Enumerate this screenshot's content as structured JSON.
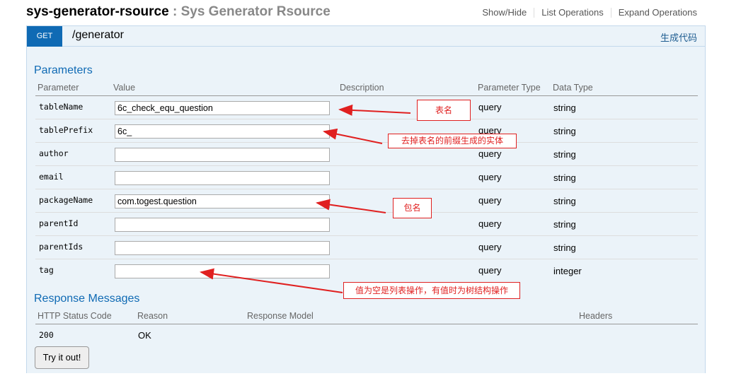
{
  "resource": {
    "name": "sys-generator-rsource",
    "separator": " : ",
    "description": "Sys Generator Rsource",
    "links": [
      "Show/Hide",
      "List Operations",
      "Expand Operations"
    ]
  },
  "operation": {
    "method": "GET",
    "path": "/generator",
    "generate_link": "生成代码",
    "parameters_title": "Parameters",
    "param_headers": [
      "Parameter",
      "Value",
      "Description",
      "Parameter Type",
      "Data Type"
    ],
    "params": [
      {
        "name": "tableName",
        "value": "6c_check_equ_question",
        "type": "query",
        "datatype": "string"
      },
      {
        "name": "tablePrefix",
        "value": "6c_",
        "type": "query",
        "datatype": "string"
      },
      {
        "name": "author",
        "value": "",
        "type": "query",
        "datatype": "string"
      },
      {
        "name": "email",
        "value": "",
        "type": "query",
        "datatype": "string"
      },
      {
        "name": "packageName",
        "value": "com.togest.question",
        "type": "query",
        "datatype": "string"
      },
      {
        "name": "parentId",
        "value": "",
        "type": "query",
        "datatype": "string"
      },
      {
        "name": "parentIds",
        "value": "",
        "type": "query",
        "datatype": "string"
      },
      {
        "name": "tag",
        "value": "",
        "type": "query",
        "datatype": "integer"
      }
    ],
    "response_title": "Response Messages",
    "response_headers": [
      "HTTP Status Code",
      "Reason",
      "Response Model",
      "Headers"
    ],
    "responses": [
      {
        "code": "200",
        "reason": "OK"
      }
    ],
    "try_button": "Try it out!"
  },
  "annotations": [
    {
      "text": "表名"
    },
    {
      "text": "去掉表名的前缀生成的实体"
    },
    {
      "text": "包名"
    },
    {
      "text": "值为空是列表操作，有值时为树结构操作"
    }
  ],
  "colors": {
    "method_get": "#0f6ab4",
    "annotation": "#e02020",
    "panel_bg": "#ebf3f9"
  }
}
